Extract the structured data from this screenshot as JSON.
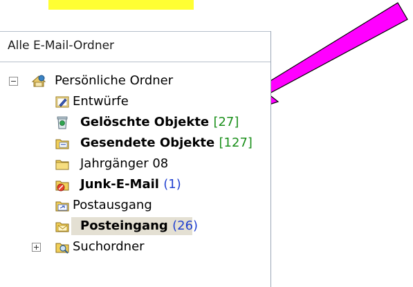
{
  "panel": {
    "header": "Alle E-Mail-Ordner"
  },
  "tree": {
    "root": {
      "label": "Persönliche Ordner",
      "icon": "personal-folders-icon",
      "expanded": true
    },
    "items": [
      {
        "label": "Entwürfe",
        "icon": "drafts-icon",
        "bold": false,
        "count": ""
      },
      {
        "label": "Gelöschte Objekte",
        "icon": "deleted-items-icon",
        "bold": true,
        "count": "[27]",
        "count_color": "#1a8f1a"
      },
      {
        "label": "Gesendete Objekte",
        "icon": "sent-items-icon",
        "bold": true,
        "count": "[127]",
        "count_color": "#1a8f1a"
      },
      {
        "label": "Jahrgänger 08",
        "icon": "folder-icon",
        "bold": false,
        "count": ""
      },
      {
        "label": "Junk-E-Mail",
        "icon": "junk-mail-icon",
        "bold": true,
        "count": "(1)",
        "count_color": "#1f3fd0"
      },
      {
        "label": "Postausgang",
        "icon": "outbox-icon",
        "bold": false,
        "count": ""
      },
      {
        "label": "Posteingang",
        "icon": "inbox-icon",
        "bold": true,
        "count": "(26)",
        "count_color": "#1f3fd0",
        "selected": true
      }
    ],
    "search": {
      "label": "Suchordner",
      "icon": "search-folders-icon",
      "expanded": false
    }
  },
  "annotation": {
    "arrow_color": "#ff00ff",
    "highlight_color": "#ffff33"
  }
}
